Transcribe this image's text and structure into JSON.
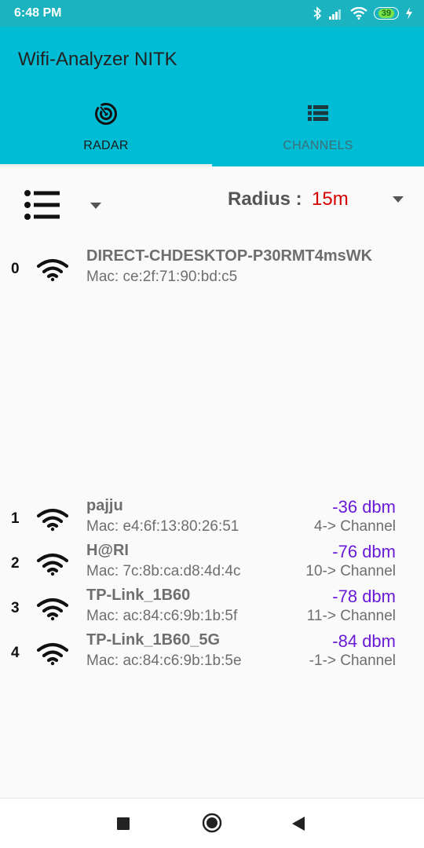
{
  "status_bar": {
    "time": "6:48 PM",
    "battery": "39",
    "icons": [
      "bluetooth-icon",
      "signal-icon",
      "wifi-icon",
      "battery-icon",
      "charging-icon"
    ]
  },
  "app": {
    "title": "Wifi-Analyzer NITK",
    "colors": {
      "primary": "#00bcd4",
      "status_bar": "#1ab3bf",
      "dbm": "#6a1bd8",
      "radius": "#d50000"
    }
  },
  "tabs": [
    {
      "label": "RADAR",
      "icon": "radar-icon",
      "selected": true
    },
    {
      "label": "CHANNELS",
      "icon": "list-icon",
      "selected": false
    }
  ],
  "controls": {
    "sort_icon": "list-icon",
    "radius_label": "Radius : ",
    "radius_value": "15m"
  },
  "networks": [
    {
      "index": "0",
      "ssid": "DIRECT-CHDESKTOP-P30RMT4msWK",
      "mac": "Mac: ce:2f:71:90:bd:c5",
      "dbm": "",
      "channel": ""
    },
    {
      "index": "1",
      "ssid": "pajju",
      "mac": "Mac: e4:6f:13:80:26:51",
      "dbm": "-36 dbm",
      "channel": "4-> Channel"
    },
    {
      "index": "2",
      "ssid": "H@RI",
      "mac": "Mac: 7c:8b:ca:d8:4d:4c",
      "dbm": "-76 dbm",
      "channel": "10-> Channel"
    },
    {
      "index": "3",
      "ssid": "TP-Link_1B60",
      "mac": "Mac: ac:84:c6:9b:1b:5f",
      "dbm": "-78 dbm",
      "channel": "11-> Channel"
    },
    {
      "index": "4",
      "ssid": "TP-Link_1B60_5G",
      "mac": "Mac: ac:84:c6:9b:1b:5e",
      "dbm": "-84 dbm",
      "channel": "-1-> Channel"
    }
  ],
  "nav": [
    "recents-icon",
    "home-icon",
    "back-icon"
  ]
}
